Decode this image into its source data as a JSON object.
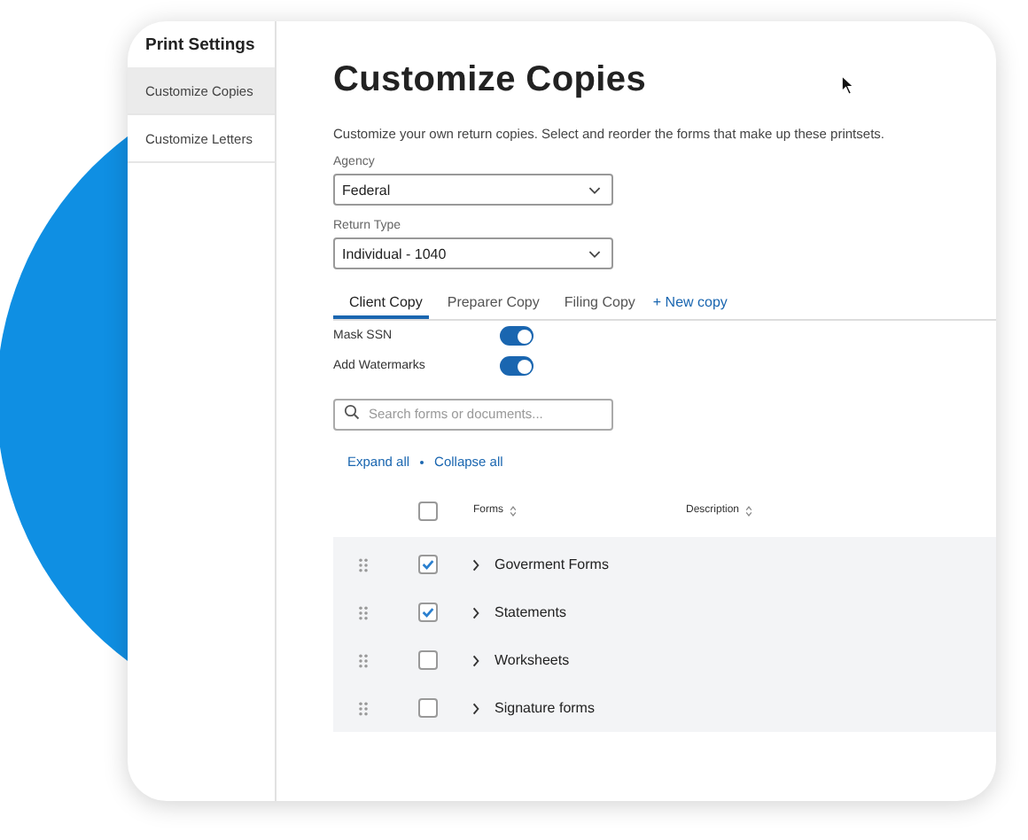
{
  "sidebar": {
    "title": "Print Settings",
    "items": [
      {
        "label": "Customize Copies",
        "selected": true
      },
      {
        "label": "Customize Letters",
        "selected": false
      }
    ]
  },
  "page": {
    "title": "Customize Copies",
    "subtitle": "Customize your own return copies. Select and reorder the forms that make up these printsets."
  },
  "fields": [
    {
      "label": "Agency",
      "value": "Federal"
    },
    {
      "label": "Return Type",
      "value": "Individual - 1040"
    }
  ],
  "tabs": [
    {
      "label": "Client Copy",
      "selected": true
    },
    {
      "label": "Preparer Copy",
      "selected": false
    },
    {
      "label": "Filing Copy",
      "selected": false
    }
  ],
  "new_copy": "+ New copy",
  "toggles": [
    {
      "label": "Mask SSN",
      "on": true
    },
    {
      "label": "Add Watermarks",
      "on": true
    }
  ],
  "search": {
    "placeholder": "Search forms or documents..."
  },
  "links": [
    "Expand all",
    "Collapse all"
  ],
  "table": {
    "all_checked": false,
    "columns": [
      "Forms",
      "Description"
    ],
    "rows": [
      {
        "name": "Goverment Forms",
        "checked": true
      },
      {
        "name": "Statements",
        "checked": true
      },
      {
        "name": "Worksheets",
        "checked": false
      },
      {
        "name": "Signature forms",
        "checked": false
      }
    ]
  }
}
